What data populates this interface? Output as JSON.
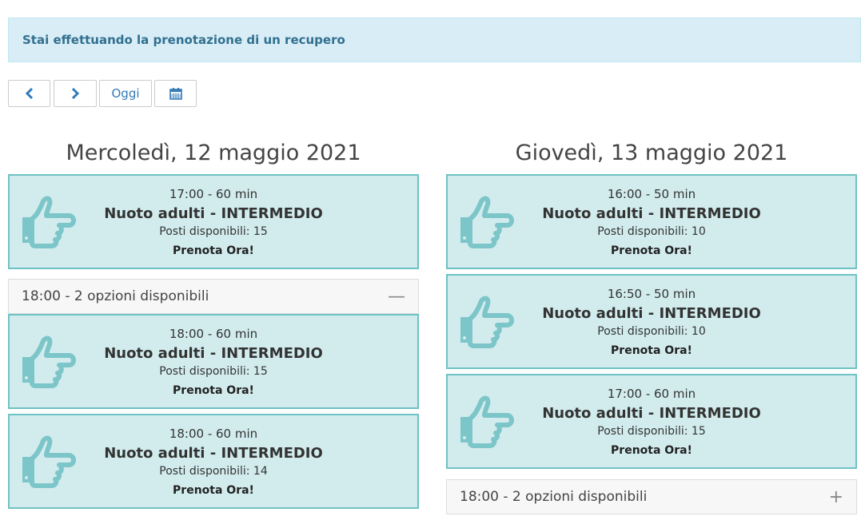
{
  "alert": {
    "text": "Stai effettuando la prenotazione di un recupero"
  },
  "toolbar": {
    "today_label": "Oggi"
  },
  "days": [
    {
      "title": "Mercoledì, 12 maggio 2021",
      "slots": [
        {
          "time": "17:00 - 60 min",
          "course": "Nuoto adulti - INTERMEDIO",
          "seats": "Posti disponibili: 15",
          "cta": "Prenota Ora!"
        }
      ],
      "group": {
        "label": "18:00 - 2 opzioni disponibili",
        "toggle": "—"
      },
      "group_slots": [
        {
          "time": "18:00 - 60 min",
          "course": "Nuoto adulti - INTERMEDIO",
          "seats": "Posti disponibili: 15",
          "cta": "Prenota Ora!"
        },
        {
          "time": "18:00 - 60 min",
          "course": "Nuoto adulti - INTERMEDIO",
          "seats": "Posti disponibili: 14",
          "cta": "Prenota Ora!"
        }
      ]
    },
    {
      "title": "Giovedì, 13 maggio 2021",
      "slots": [
        {
          "time": "16:00 - 50 min",
          "course": "Nuoto adulti - INTERMEDIO",
          "seats": "Posti disponibili: 10",
          "cta": "Prenota Ora!"
        },
        {
          "time": "16:50 - 50 min",
          "course": "Nuoto adulti - INTERMEDIO",
          "seats": "Posti disponibili: 10",
          "cta": "Prenota Ora!"
        },
        {
          "time": "17:00 - 60 min",
          "course": "Nuoto adulti - INTERMEDIO",
          "seats": "Posti disponibili: 15",
          "cta": "Prenota Ora!"
        }
      ],
      "group": {
        "label": "18:00 - 2 opzioni disponibili",
        "toggle": "+"
      }
    }
  ],
  "colors": {
    "slot_bg": "#d2ecee",
    "slot_border": "#6fc2c4",
    "hand_icon": "#7cc5c8",
    "alert_bg": "#d9edf7",
    "alert_text": "#31708f",
    "link": "#337ab7"
  }
}
